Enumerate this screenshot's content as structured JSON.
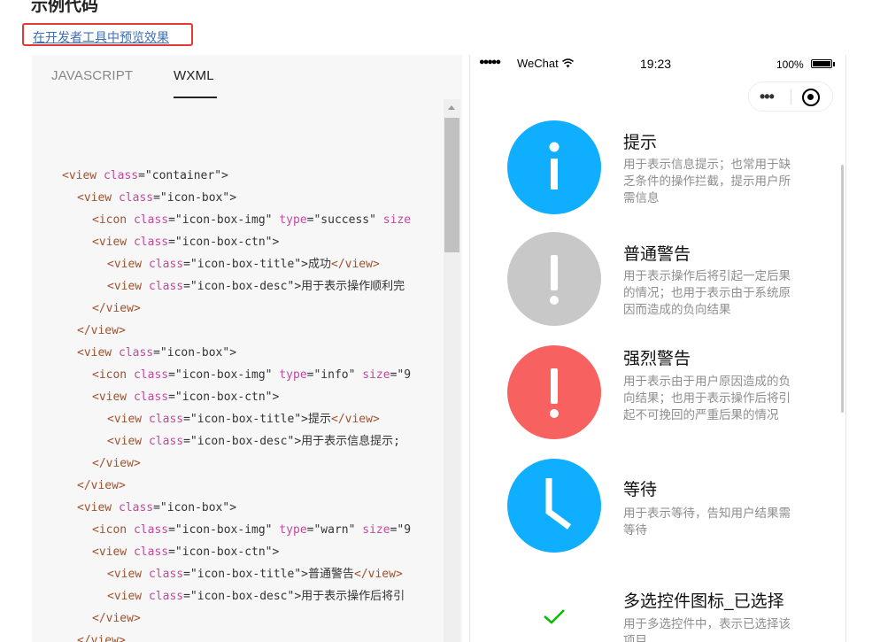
{
  "heading": "示例代码",
  "preview_link": "在开发者工具中预览效果",
  "code_tabs": [
    "JAVASCRIPT",
    "WXML"
  ],
  "code_lines": [
    {
      "indent": 0,
      "parts": [
        [
          "t",
          "<view "
        ],
        [
          "a",
          "class"
        ],
        [
          "v",
          "=\"container\">"
        ]
      ]
    },
    {
      "indent": 1,
      "parts": [
        [
          "t",
          "<view "
        ],
        [
          "a",
          "class"
        ],
        [
          "v",
          "=\"icon-box\">"
        ]
      ]
    },
    {
      "indent": 2,
      "parts": [
        [
          "t",
          "<icon "
        ],
        [
          "a",
          "class"
        ],
        [
          "v",
          "=\"icon-box-img\" "
        ],
        [
          "a",
          "type"
        ],
        [
          "v",
          "=\"success\" "
        ],
        [
          "a",
          "size"
        ]
      ]
    },
    {
      "indent": 2,
      "parts": [
        [
          "t",
          "<view "
        ],
        [
          "a",
          "class"
        ],
        [
          "v",
          "=\"icon-box-ctn\">"
        ]
      ]
    },
    {
      "indent": 3,
      "parts": [
        [
          "t",
          "<view "
        ],
        [
          "a",
          "class"
        ],
        [
          "v",
          "=\"icon-box-title\">成功"
        ],
        [
          "t",
          "</view>"
        ]
      ]
    },
    {
      "indent": 3,
      "parts": [
        [
          "t",
          "<view "
        ],
        [
          "a",
          "class"
        ],
        [
          "v",
          "=\"icon-box-desc\">用于表示操作顺利完"
        ]
      ]
    },
    {
      "indent": 2,
      "parts": [
        [
          "t",
          "</view>"
        ]
      ]
    },
    {
      "indent": 1,
      "parts": [
        [
          "t",
          "</view>"
        ]
      ]
    },
    {
      "indent": 1,
      "parts": [
        [
          "t",
          "<view "
        ],
        [
          "a",
          "class"
        ],
        [
          "v",
          "=\"icon-box\">"
        ]
      ]
    },
    {
      "indent": 2,
      "parts": [
        [
          "t",
          "<icon "
        ],
        [
          "a",
          "class"
        ],
        [
          "v",
          "=\"icon-box-img\" "
        ],
        [
          "a",
          "type"
        ],
        [
          "v",
          "=\"info\" "
        ],
        [
          "a",
          "size"
        ],
        [
          "v",
          "=\"9"
        ]
      ]
    },
    {
      "indent": 2,
      "parts": [
        [
          "t",
          "<view "
        ],
        [
          "a",
          "class"
        ],
        [
          "v",
          "=\"icon-box-ctn\">"
        ]
      ]
    },
    {
      "indent": 3,
      "parts": [
        [
          "t",
          "<view "
        ],
        [
          "a",
          "class"
        ],
        [
          "v",
          "=\"icon-box-title\">提示"
        ],
        [
          "t",
          "</view>"
        ]
      ]
    },
    {
      "indent": 3,
      "parts": [
        [
          "t",
          "<view "
        ],
        [
          "a",
          "class"
        ],
        [
          "v",
          "=\"icon-box-desc\">用于表示信息提示;"
        ]
      ]
    },
    {
      "indent": 2,
      "parts": [
        [
          "t",
          "</view>"
        ]
      ]
    },
    {
      "indent": 1,
      "parts": [
        [
          "t",
          "</view>"
        ]
      ]
    },
    {
      "indent": 1,
      "parts": [
        [
          "t",
          "<view "
        ],
        [
          "a",
          "class"
        ],
        [
          "v",
          "=\"icon-box\">"
        ]
      ]
    },
    {
      "indent": 2,
      "parts": [
        [
          "t",
          "<icon "
        ],
        [
          "a",
          "class"
        ],
        [
          "v",
          "=\"icon-box-img\" "
        ],
        [
          "a",
          "type"
        ],
        [
          "v",
          "=\"warn\" "
        ],
        [
          "a",
          "size"
        ],
        [
          "v",
          "=\"9"
        ]
      ]
    },
    {
      "indent": 2,
      "parts": [
        [
          "t",
          "<view "
        ],
        [
          "a",
          "class"
        ],
        [
          "v",
          "=\"icon-box-ctn\">"
        ]
      ]
    },
    {
      "indent": 3,
      "parts": [
        [
          "t",
          "<view "
        ],
        [
          "a",
          "class"
        ],
        [
          "v",
          "=\"icon-box-title\">普通警告"
        ],
        [
          "t",
          "</view>"
        ]
      ]
    },
    {
      "indent": 3,
      "parts": [
        [
          "t",
          "<view "
        ],
        [
          "a",
          "class"
        ],
        [
          "v",
          "=\"icon-box-desc\">用于表示操作后将引"
        ]
      ]
    },
    {
      "indent": 2,
      "parts": [
        [
          "t",
          "</view>"
        ]
      ]
    },
    {
      "indent": 1,
      "parts": [
        [
          "t",
          "</view>"
        ]
      ]
    }
  ],
  "status_bar": {
    "signal": "●●●●●",
    "carrier": "WeChat",
    "time": "19:23",
    "battery": "100%"
  },
  "capsule": {
    "menu": "•••"
  },
  "icon_boxes": [
    {
      "title": "提示",
      "desc": "用于表示信息提示；也常用于缺乏条件的操作拦截，提示用户所需信息",
      "icon": "info-icon",
      "color": "#10aeff"
    },
    {
      "title": "普通警告",
      "desc": "用于表示操作后将引起一定后果的情况；也用于表示由于系统原因而造成的负向结果",
      "icon": "warn-icon",
      "color": "#c8c8c8"
    },
    {
      "title": "强烈警告",
      "desc": "用于表示由于用户原因造成的负向结果；也用于表示操作后将引起不可挽回的严重后果的情况",
      "icon": "warn-icon",
      "color": "#f76260"
    },
    {
      "title": "等待",
      "desc": "用于表示等待，告知用户结果需等待",
      "icon": "clock-icon",
      "color": "#10aeff"
    },
    {
      "title": "多选控件图标_已选择",
      "desc": "用于多选控件中，表示已选择该项目",
      "icon": "checkmark-icon",
      "color": "#09bb07"
    }
  ]
}
